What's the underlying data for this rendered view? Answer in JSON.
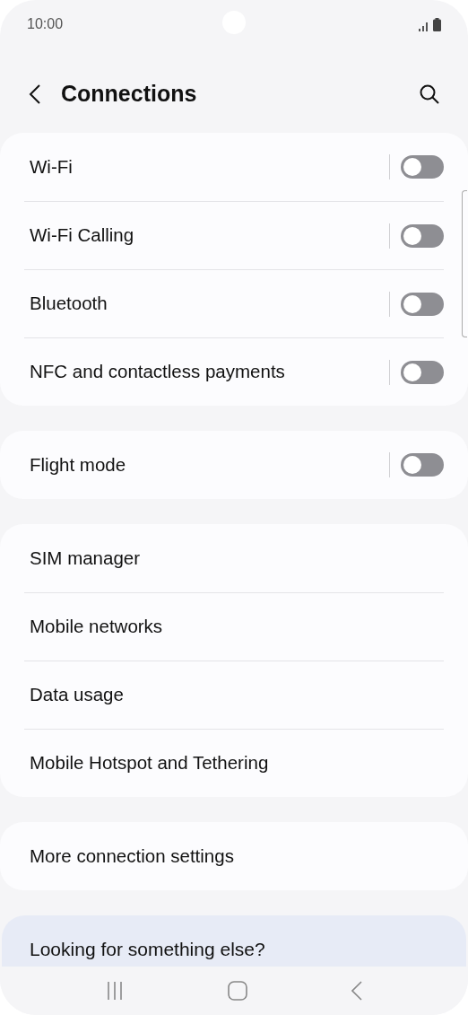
{
  "status_bar": {
    "time": "10:00"
  },
  "header": {
    "title": "Connections"
  },
  "sections": [
    {
      "items": [
        {
          "label": "Wi-Fi",
          "kind": "toggle",
          "on": false
        },
        {
          "label": "Wi-Fi Calling",
          "kind": "toggle",
          "on": false
        },
        {
          "label": "Bluetooth",
          "kind": "toggle",
          "on": false
        },
        {
          "label": "NFC and contactless payments",
          "kind": "toggle",
          "on": false
        }
      ]
    },
    {
      "items": [
        {
          "label": "Flight mode",
          "kind": "toggle",
          "on": false
        }
      ]
    },
    {
      "items": [
        {
          "label": "SIM manager",
          "kind": "link"
        },
        {
          "label": "Mobile networks",
          "kind": "link"
        },
        {
          "label": "Data usage",
          "kind": "link"
        },
        {
          "label": "Mobile Hotspot and Tethering",
          "kind": "link"
        }
      ]
    },
    {
      "items": [
        {
          "label": "More connection settings",
          "kind": "link"
        }
      ]
    }
  ],
  "suggestion": {
    "title": "Looking for something else?"
  }
}
